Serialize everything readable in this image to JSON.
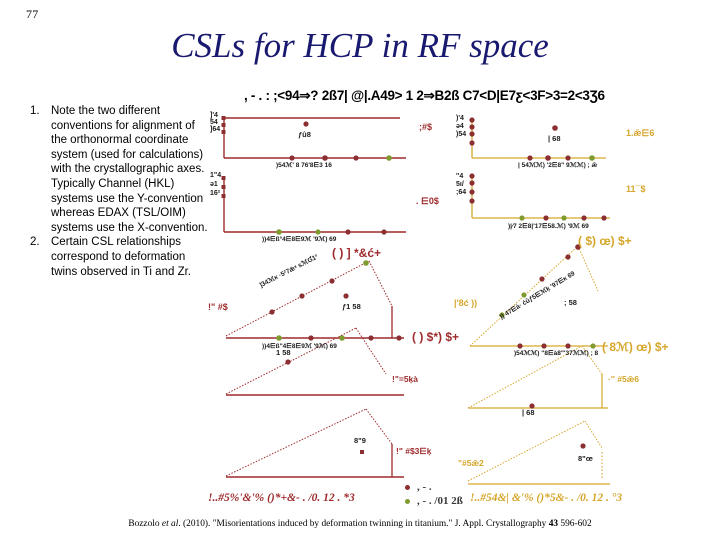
{
  "slide": {
    "page_number": "77",
    "title": "CSLs for HCP in RF space",
    "figure_header": ", - . : ;<94⇒? 2ß7| @|.A49> 1 2⇒B2ß C7<D|E7ƹ<3F>3=2<3Ʒ6",
    "bullets": [
      {
        "number": "1.",
        "text": "Note the two different conventions for alignment of the orthonormal coordinate system (used for calculations) with the crystallographic axes.  Typically Channel (HKL) systems use the Y-convention whereas EDAX (TSL/OIM) systems use the X-convention."
      },
      {
        "number": "2.",
        "text": "Certain CSL relationships correspond to deformation twins observed in Ti and Zr."
      }
    ],
    "left_panel": {
      "accent_color": "#9e2a2b",
      "caption": "!..#5%'&'% ()*+&- . /0. 12 . *3",
      "axis_labels_1": [
        "]'4",
        "54",
        "]64"
      ],
      "axis_labels_2": [
        "1\"4",
        "ǝ1",
        "16²"
      ],
      "point_label_top": "ƒû8",
      "tick_label_1": ")54ℳ' 8 76'8⋿3 16",
      "tick_label_2": "))4⋿ß°4⋿8⋿9ℳ '9ℳ) 69",
      "tick_label_3": "))4⋿ß\"4⋿8⋿9ℳ '9ℳ) 69",
      "side_label_1": ";#$",
      "side_label_2": ". ⋿0$",
      "annot_diag": "]34ℳĸ ·5²7ǣˣ sℳƓ1³",
      "annot_corner_1": "( ) ] *&ć+",
      "annot_corner_2": "( ) $*) $+",
      "annot_left": "!\" #$",
      "annot_mid": "ƒ1 58",
      "annot_low_1": "!\"=5ķà",
      "annot_low_2": "!\" #$3⋿ķ",
      "annot_lower_val_1": "1 58",
      "annot_lower_val_2": "8\"9"
    },
    "right_panel": {
      "accent_color": "#d6a62b",
      "caption": "!..#54&| &'% ()*5&- . /0. 12 . °3",
      "axis_labels_1": [
        ")'4",
        "ǝ4",
        ")54"
      ],
      "axis_labels_2": [
        "''4",
        "5ı/",
        ";64"
      ],
      "point_label_top": "| 68",
      "tick_label_1": "| 54ℳℳ) '2⋿8\" 9ℳℳ) ; ǣ",
      "tick_label_2": ")|⁄7 2⋿8|'17⋿58.ℳ) '9ℳ 69",
      "tick_label_3": ")54ℳℳ) \"8⋿à8\"'37ℳℳ) ; 8",
      "side_label_1": "1.ǣ⋿6",
      "side_label_2": "11¯$",
      "annot_diag": ")) 47⋿à· ćûƒ5⋿ℳķ '97⋿ĸ 69",
      "annot_corner_1": "( $) œ) $+",
      "annot_corner_2": "( 8ℳ) œ) $+",
      "annot_left": "|'8ć ))",
      "annot_mid": "; 58",
      "annot_low_1": "·'' #5ǣ6",
      "annot_low_2": "\"#5ǣ2",
      "annot_lower_val_1": "| 68",
      "annot_lower_val_2": "8\"œ"
    },
    "legend": [
      {
        "dot": "red",
        "color": "#8b2f33",
        "label": ", - ."
      },
      {
        "dot": "green",
        "color": "#7f9a2e",
        "label": ", - . /01 2ß"
      }
    ],
    "footer": {
      "authors": "Bozzolo ",
      "etal": "et al",
      "rest": ". (2010). \"Misorientations induced by deformation twinning in titanium.\" J. Appl. Crystallography ",
      "volume": "43",
      "pages": " 596-602"
    }
  }
}
